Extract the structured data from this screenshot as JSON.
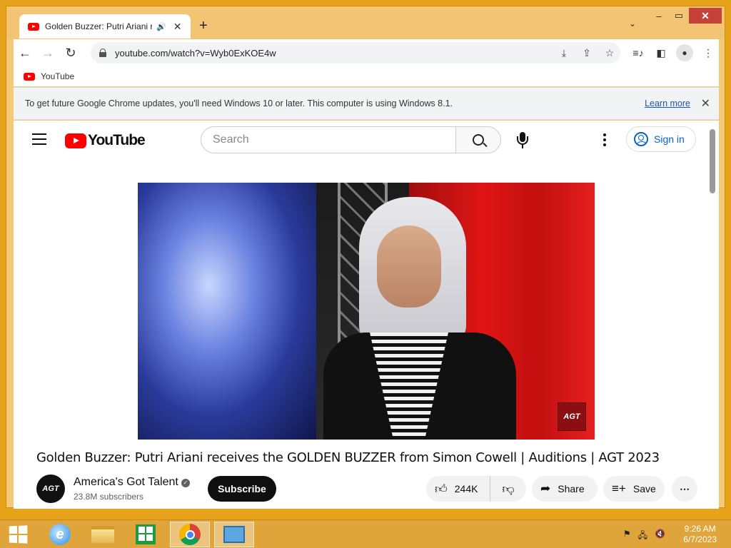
{
  "browser": {
    "tab_title": "Golden Buzzer: Putri Ariani re",
    "url": "youtube.com/watch?v=Wyb0ExKOE4w",
    "bookmark_label": "YouTube",
    "infobar_text": "To get future Google Chrome updates, you'll need Windows 10 or later. This computer is using Windows 8.1.",
    "infobar_link": "Learn more"
  },
  "youtube": {
    "logo_text": "YouTube",
    "search_placeholder": "Search",
    "signin_label": "Sign in",
    "video_title": "Golden Buzzer: Putri Ariani receives the GOLDEN BUZZER from Simon Cowell | Auditions | AGT 2023",
    "channel_name": "America's Got Talent",
    "subscribers": "23.8M subscribers",
    "subscribe_label": "Subscribe",
    "like_count": "244K",
    "share_label": "Share",
    "save_label": "Save",
    "watermark": "AGT",
    "channel_avatar_text": "AGT"
  },
  "taskbar": {
    "time": "9:26 AM",
    "date": "6/7/2023"
  },
  "colors": {
    "youtube_red": "#ff0000",
    "desktop_orange": "#e7a41a",
    "link_blue": "#065fd4"
  }
}
